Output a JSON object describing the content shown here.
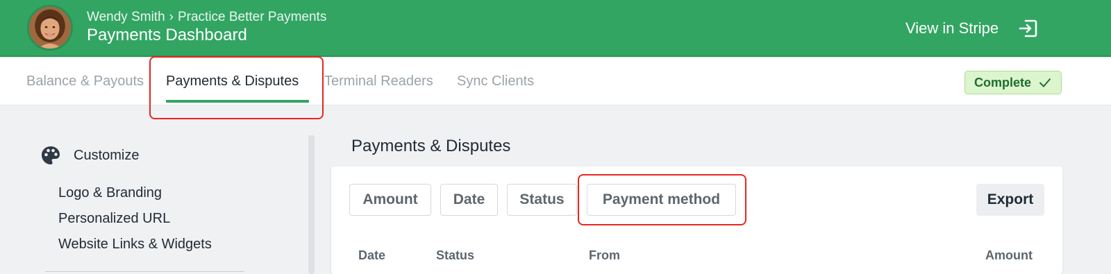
{
  "header": {
    "breadcrumb_user": "Wendy Smith",
    "breadcrumb_separator": "›",
    "breadcrumb_page": "Practice Better Payments",
    "title": "Payments Dashboard",
    "view_in_stripe_label": "View in Stripe",
    "view_in_stripe_icon": "exit-arrow-icon",
    "avatar_icon": "user-avatar"
  },
  "tabs": [
    {
      "label": "Balance & Payouts",
      "active": false
    },
    {
      "label": "Payments & Disputes",
      "active": true
    },
    {
      "label": "Terminal Readers",
      "active": false
    },
    {
      "label": "Sync Clients",
      "active": false
    }
  ],
  "status_badge": {
    "label": "Complete",
    "icon": "check-icon"
  },
  "sidebar": {
    "section_label": "Customize",
    "section_icon": "palette-icon",
    "items": [
      {
        "label": "Logo & Branding"
      },
      {
        "label": "Personalized URL"
      },
      {
        "label": "Website Links & Widgets"
      }
    ]
  },
  "main": {
    "title": "Payments & Disputes",
    "filters": [
      {
        "label": "Amount"
      },
      {
        "label": "Date"
      },
      {
        "label": "Status"
      },
      {
        "label": "Payment method"
      }
    ],
    "export_label": "Export",
    "table_headers": [
      "Date",
      "Status",
      "From",
      "Amount"
    ]
  },
  "colors": {
    "header_green": "#32a563",
    "highlight_red": "#e6261f",
    "badge_bg": "#dcf5cf",
    "badge_text": "#1d6e2e"
  }
}
